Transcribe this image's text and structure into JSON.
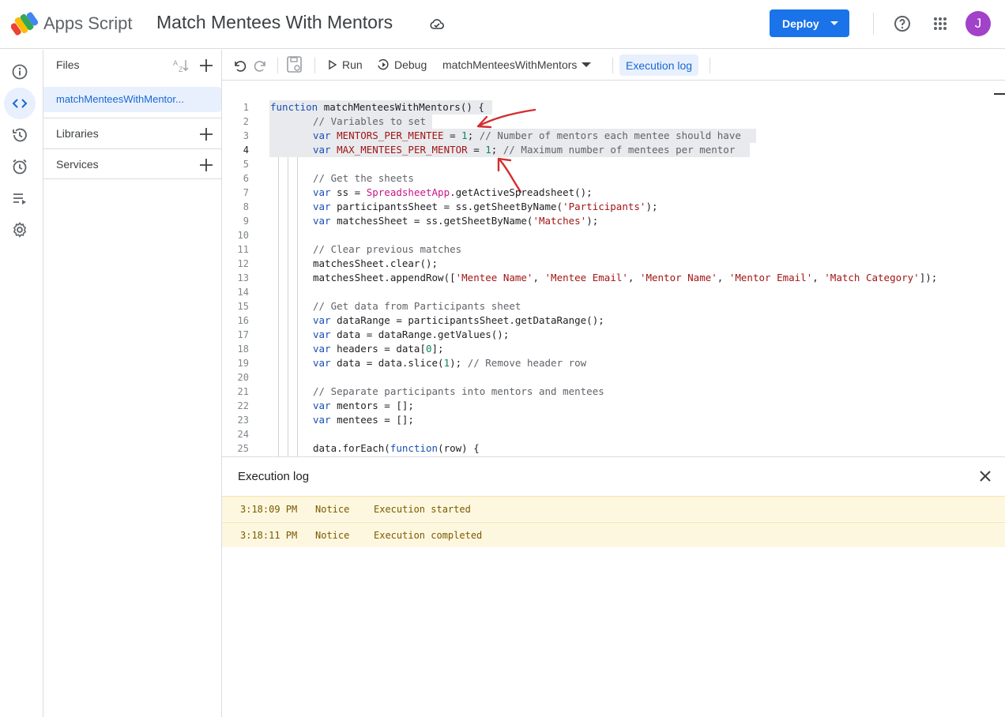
{
  "app": {
    "name": "Apps Script",
    "project_title": "Match Mentees With Mentors",
    "avatar_initial": "J"
  },
  "header": {
    "deploy_label": "Deploy"
  },
  "colors": {
    "accent": "#1a73e8",
    "avatar": "#a142c9",
    "log_background": "#fef7e0"
  },
  "rail": {
    "icons": [
      "info-icon",
      "code-icon",
      "history-icon",
      "alarm-icon",
      "executions-icon",
      "settings-icon"
    ],
    "active": "code-icon"
  },
  "sidebar": {
    "files_title": "Files",
    "file_name": "matchMenteesWithMentor...",
    "libraries_label": "Libraries",
    "services_label": "Services"
  },
  "toolbar": {
    "run_label": "Run",
    "debug_label": "Debug",
    "function_select": "matchMenteesWithMentors",
    "exec_log_label": "Execution log"
  },
  "editor": {
    "current_line": 4,
    "lines": [
      {
        "n": "1",
        "t": "function matchMenteesWithMentors() {"
      },
      {
        "n": "2",
        "t": "  // Variables to set"
      },
      {
        "n": "3",
        "t": "  var MENTORS_PER_MENTEE = 1; // Number of mentors each mentee should have"
      },
      {
        "n": "4",
        "t": "  var MAX_MENTEES_PER_MENTOR = 1; // Maximum number of mentees per mentor"
      },
      {
        "n": "5",
        "t": ""
      },
      {
        "n": "6",
        "t": "  // Get the sheets"
      },
      {
        "n": "7",
        "t": "  var ss = SpreadsheetApp.getActiveSpreadsheet();"
      },
      {
        "n": "8",
        "t": "  var participantsSheet = ss.getSheetByName('Participants');"
      },
      {
        "n": "9",
        "t": "  var matchesSheet = ss.getSheetByName('Matches');"
      },
      {
        "n": "10",
        "t": ""
      },
      {
        "n": "11",
        "t": "  // Clear previous matches"
      },
      {
        "n": "12",
        "t": "  matchesSheet.clear();"
      },
      {
        "n": "13",
        "t": "  matchesSheet.appendRow(['Mentee Name', 'Mentee Email', 'Mentor Name', 'Mentor Email', 'Match Category']);"
      },
      {
        "n": "14",
        "t": ""
      },
      {
        "n": "15",
        "t": "  // Get data from Participants sheet"
      },
      {
        "n": "16",
        "t": "  var dataRange = participantsSheet.getDataRange();"
      },
      {
        "n": "17",
        "t": "  var data = dataRange.getValues();"
      },
      {
        "n": "18",
        "t": "  var headers = data[0];"
      },
      {
        "n": "19",
        "t": "  var data = data.slice(1); // Remove header row"
      },
      {
        "n": "20",
        "t": ""
      },
      {
        "n": "21",
        "t": "  // Separate participants into mentors and mentees"
      },
      {
        "n": "22",
        "t": "  var mentors = [];"
      },
      {
        "n": "23",
        "t": "  var mentees = [];"
      },
      {
        "n": "24",
        "t": ""
      },
      {
        "n": "25",
        "t": "  data.forEach(function(row) {"
      }
    ]
  },
  "log": {
    "title": "Execution log",
    "rows": [
      {
        "time": "3:18:09 PM",
        "level": "Notice",
        "message": "Execution started"
      },
      {
        "time": "3:18:11 PM",
        "level": "Notice",
        "message": "Execution completed"
      }
    ]
  }
}
